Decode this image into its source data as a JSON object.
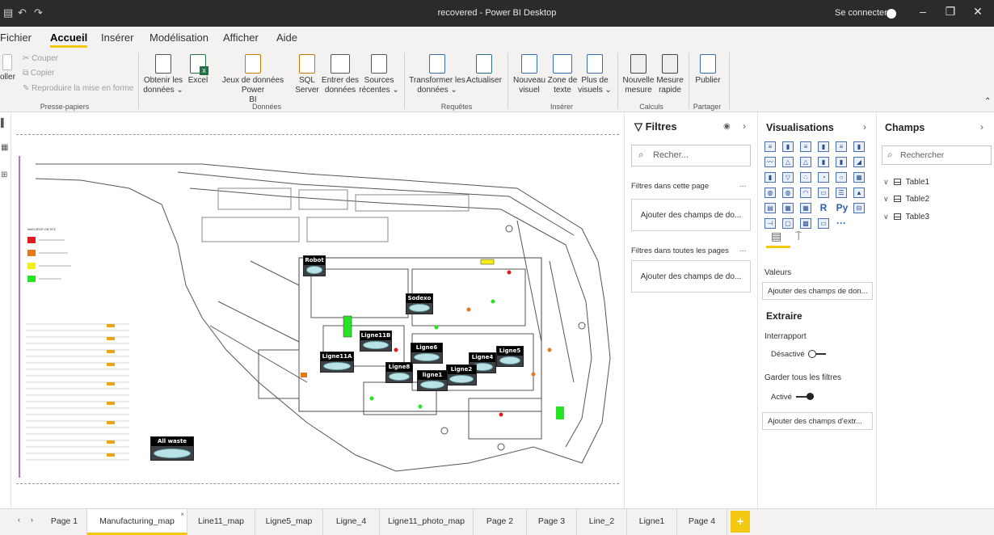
{
  "window": {
    "title": "recovered - Power BI Desktop",
    "signin": "Se connecter",
    "minimize": "–",
    "restore": "❐",
    "close": "✕"
  },
  "ribbon_tabs": [
    "Fichier",
    "Accueil",
    "Insérer",
    "Modélisation",
    "Afficher",
    "Aide"
  ],
  "ribbon": {
    "clipboard": {
      "paste": "oller",
      "cut": "Couper",
      "copy": "Copier",
      "format_painter": "Reproduire la mise en forme",
      "group": "Presse-papiers"
    },
    "data": {
      "get_data": [
        "Obtenir les",
        "données ⌄"
      ],
      "excel": "Excel",
      "datasets": [
        "Jeux de données Power",
        "BI"
      ],
      "sql": [
        "SQL",
        "Server"
      ],
      "enter_data": [
        "Entrer des",
        "données"
      ],
      "recent_sources": [
        "Sources",
        "récentes ⌄"
      ],
      "group": "Données"
    },
    "queries": {
      "transform": [
        "Transformer les",
        "données ⌄"
      ],
      "refresh": "Actualiser",
      "group": "Requêtes"
    },
    "insert": {
      "new_visual": [
        "Nouveau",
        "visuel"
      ],
      "textbox": [
        "Zone de",
        "texte"
      ],
      "more_visuals": [
        "Plus de",
        "visuels ⌄"
      ],
      "group": "Insérer"
    },
    "calculations": {
      "new_measure": [
        "Nouvelle",
        "mesure"
      ],
      "quick_measure": [
        "Mesure",
        "rapide"
      ],
      "group": "Calculs"
    },
    "share": {
      "publish": "Publier",
      "group": "Partager"
    }
  },
  "map": {
    "sensors": [
      "Robot",
      "Sodexo",
      "Ligne11B",
      "Ligne11A",
      "Ligne6",
      "Ligne5",
      "Ligne4",
      "Ligne8",
      "Ligne2",
      "ligne1",
      "All waste"
    ],
    "legend_colors": [
      "#e01b1b",
      "#e2791a",
      "#f4ef1a",
      "#27e427"
    ]
  },
  "filters": {
    "title": "Filtres",
    "search_placeholder": "Recher...",
    "this_page": "Filtres dans cette page",
    "all_pages": "Filtres dans toutes les pages",
    "add_fields": "Ajouter des champs de do...",
    "more": "..."
  },
  "visualizations": {
    "title": "Visualisations",
    "values_label": "Valeurs",
    "add_values": "Ajouter des champs de don...",
    "drillthrough_title": "Extraire",
    "cross_report": "Interrapport",
    "cross_report_state": "Désactivé",
    "keep_filters": "Garder tous les filtres",
    "keep_filters_state": "Activé",
    "add_drill": "Ajouter des champs d'extr...",
    "text_icons": {
      "r": "R",
      "py": "Py",
      "more": "···"
    }
  },
  "fields": {
    "title": "Champs",
    "search_placeholder": "Rechercher",
    "tables": [
      "Table1",
      "Table2",
      "Table3"
    ]
  },
  "page_tabs": [
    "Page 1",
    "Manufacturing_map",
    "Line11_map",
    "Ligne5_map",
    "Ligne_4",
    "Ligne11_photo_map",
    "Page 2",
    "Page 3",
    "Line_2",
    "Ligne1",
    "Page 4"
  ],
  "active_page": "Manufacturing_map",
  "add_page": "+"
}
